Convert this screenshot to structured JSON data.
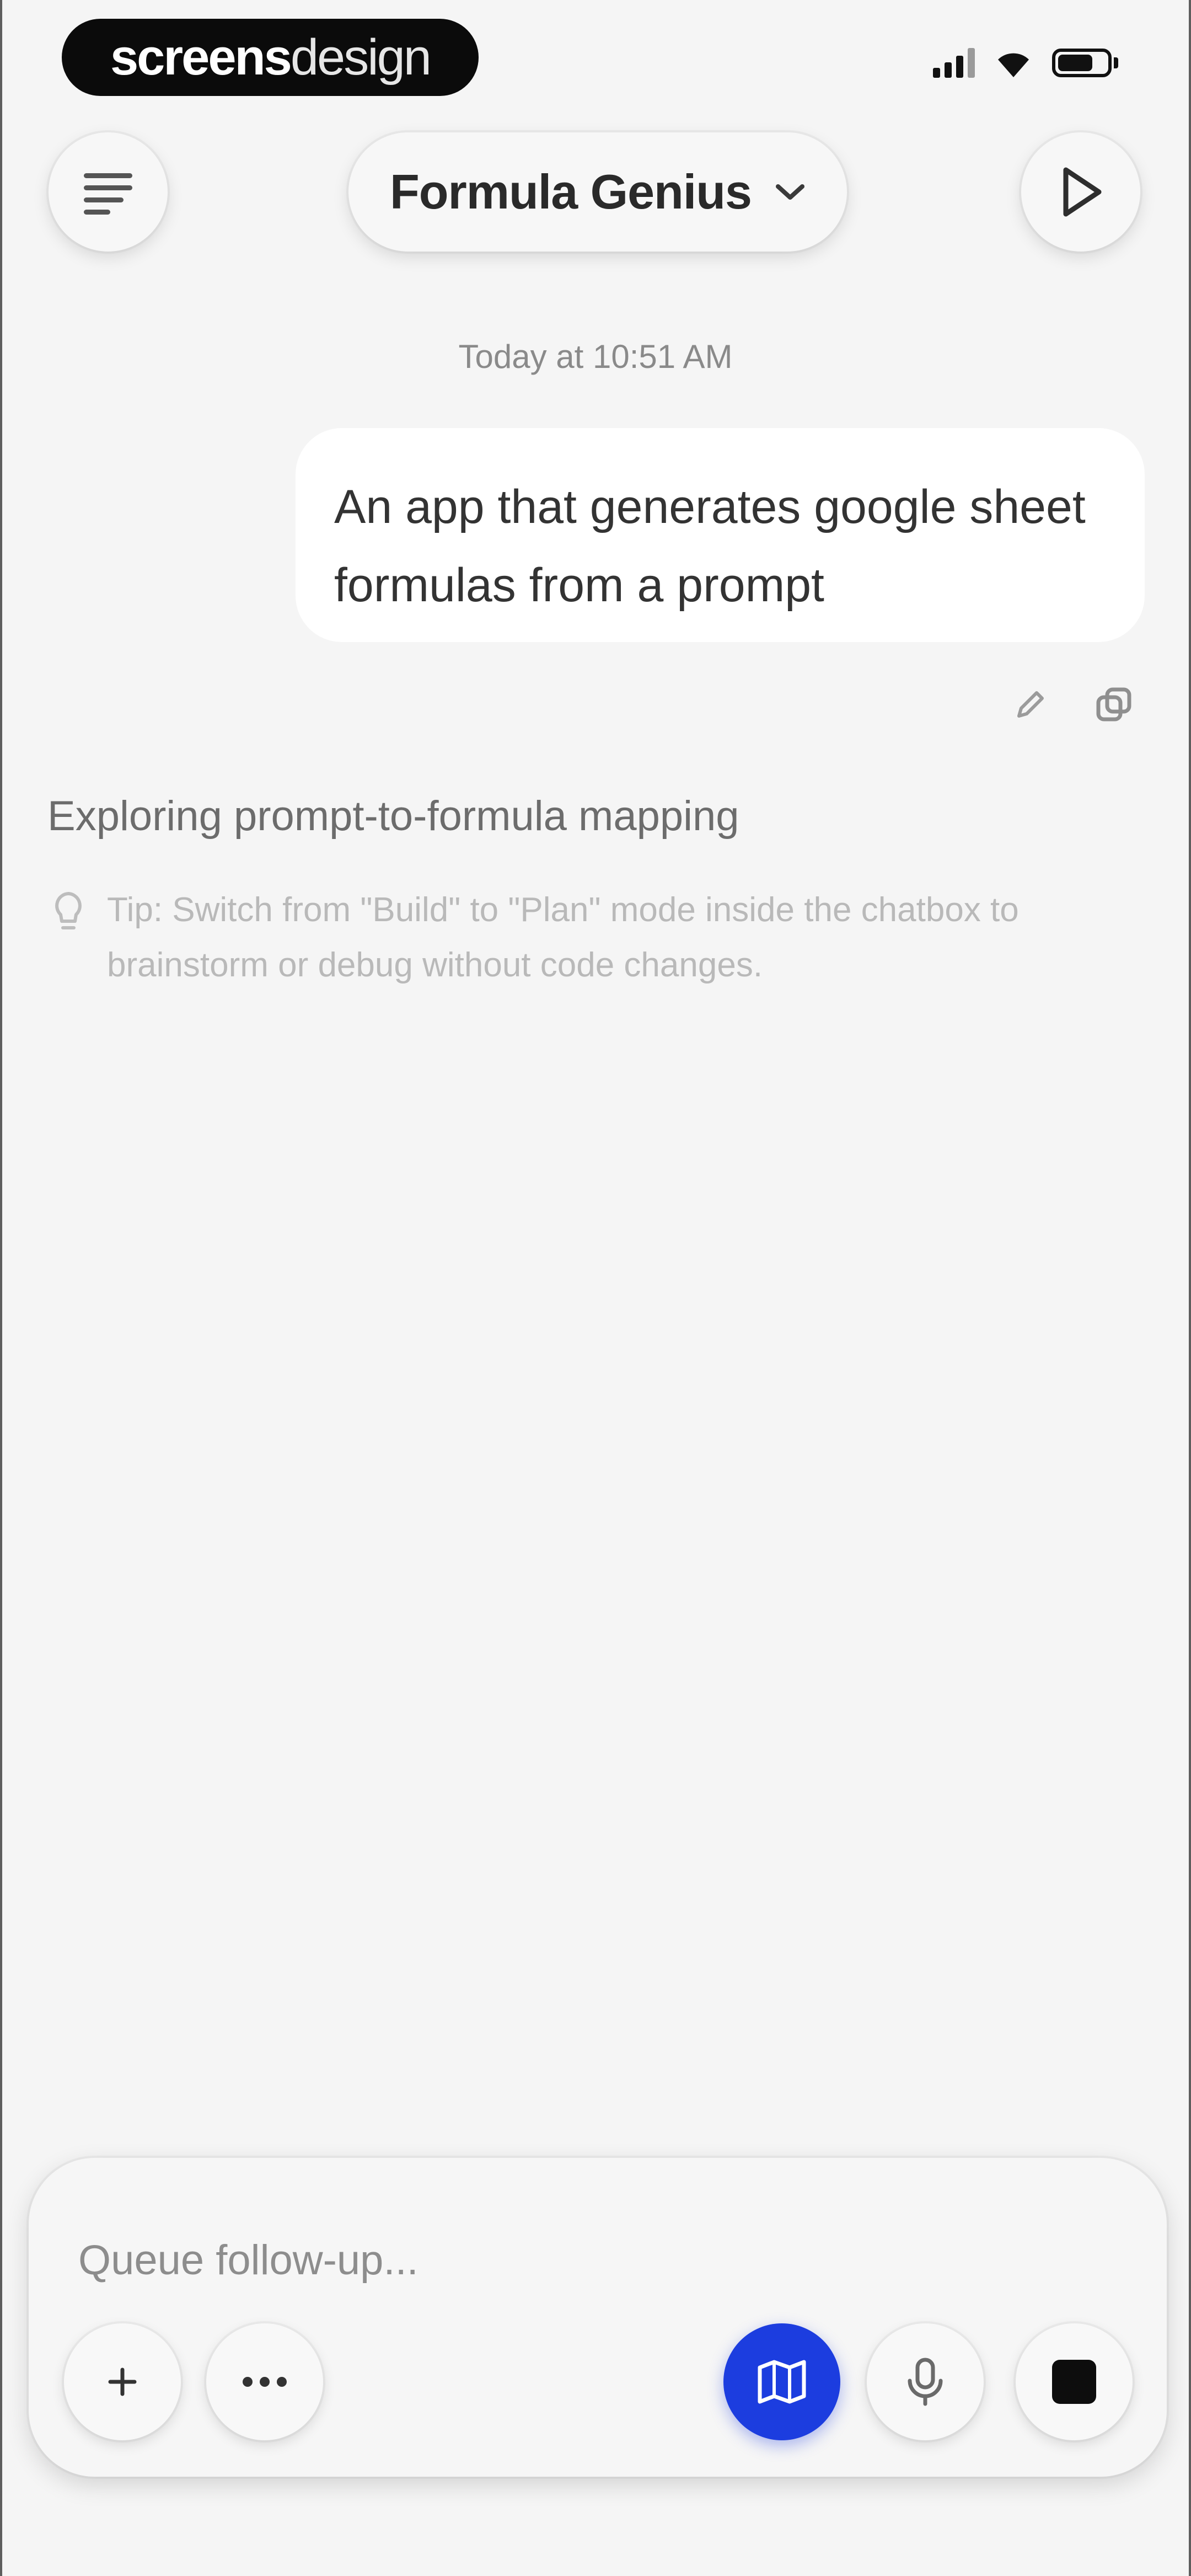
{
  "status_bar": {
    "watermark_bold": "screens",
    "watermark_light": "design"
  },
  "header": {
    "title": "Formula Genius",
    "menu_icon": "menu-lines-icon",
    "run_icon": "play-icon",
    "dropdown_icon": "chevron-down-icon"
  },
  "chat": {
    "timestamp": "Today at 10:51 AM",
    "user_message": "An app that generates google sheet formulas from a prompt",
    "status_text": "Exploring prompt-to-formula mapping",
    "tip_text": "Tip: Switch from \"Build\" to \"Plan\" mode inside the chatbox to brainstorm or debug without code changes."
  },
  "composer": {
    "placeholder": "Queue follow-up...",
    "plan_color": "#1c3ddf"
  }
}
